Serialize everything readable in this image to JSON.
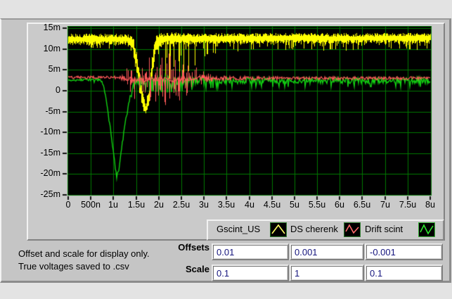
{
  "note": {
    "line1": "Offset and scale for display only.",
    "line2": "True voltages saved to .csv"
  },
  "controls": {
    "offsets": {
      "label": "Offsets",
      "values": [
        "0.01",
        "0.001",
        "-0.001"
      ]
    },
    "scale": {
      "label": "Scale",
      "values": [
        "0.1",
        "1",
        "0.1"
      ]
    },
    "value_text_color": "#15157e"
  },
  "legend": {
    "items": [
      {
        "label": "Gscint_US",
        "color": "#ffff66",
        "box_border": "#2d7a2d",
        "glyph": "2,15 11,3 20,15"
      },
      {
        "label": "DS cherenk",
        "color": "#ff6b6b",
        "box_border": "#2d7a2d",
        "glyph": "2,12 7,3 13,14 20,6"
      },
      {
        "label": "Drift scint",
        "color": "#2ee62e",
        "box_border": "#39b439",
        "glyph": "2,13 7,3 13,15 20,4"
      }
    ]
  },
  "chart_data": {
    "type": "line",
    "title": "",
    "bg": "#000000",
    "grid_color": "#007a00",
    "border_color": "#0a7a0a",
    "tick_color": "#111111",
    "grid": true,
    "legend_position": "bottom-right",
    "xlim_us": [
      0,
      8
    ],
    "ylim_mv": [
      -25,
      15
    ],
    "x_ticks": [
      {
        "label": "0",
        "us": 0
      },
      {
        "label": "500n",
        "us": 0.5
      },
      {
        "label": "1u",
        "us": 1
      },
      {
        "label": "1.5u",
        "us": 1.5
      },
      {
        "label": "2u",
        "us": 2
      },
      {
        "label": "2.5u",
        "us": 2.5
      },
      {
        "label": "3u",
        "us": 3
      },
      {
        "label": "3.5u",
        "us": 3.5
      },
      {
        "label": "4u",
        "us": 4
      },
      {
        "label": "4.5u",
        "us": 4.5
      },
      {
        "label": "5u",
        "us": 5
      },
      {
        "label": "5.5u",
        "us": 5.5
      },
      {
        "label": "6u",
        "us": 6
      },
      {
        "label": "6.5u",
        "us": 6.5
      },
      {
        "label": "7u",
        "us": 7
      },
      {
        "label": "7.5u",
        "us": 7.5
      },
      {
        "label": "8u",
        "us": 8
      }
    ],
    "y_ticks": [
      {
        "label": "15m",
        "mv": 15
      },
      {
        "label": "10m",
        "mv": 10
      },
      {
        "label": "5m",
        "mv": 5
      },
      {
        "label": "0",
        "mv": 0
      },
      {
        "label": "-5m",
        "mv": -5
      },
      {
        "label": "-10m",
        "mv": -10
      },
      {
        "label": "-15m",
        "mv": -15
      },
      {
        "label": "-20m",
        "mv": -20
      },
      {
        "label": "-25m",
        "mv": -25
      }
    ],
    "series": [
      {
        "name": "Gscint_US",
        "color": "#ffff00",
        "style": "band",
        "points": [
          [
            0,
            12.4,
            1.3,
            1.5
          ],
          [
            1.3,
            12.4,
            1.3,
            1.5
          ],
          [
            1.42,
            11.3,
            2.2,
            2
          ],
          [
            1.5,
            7.5,
            3,
            2
          ],
          [
            1.58,
            1.5,
            3,
            1.5
          ],
          [
            1.66,
            -3.2,
            2,
            0.8
          ],
          [
            1.71,
            -4.3,
            1.2,
            0.5
          ],
          [
            1.77,
            -1.5,
            2.5,
            1
          ],
          [
            1.84,
            5,
            3,
            2
          ],
          [
            1.92,
            11,
            2.2,
            3
          ],
          [
            2.02,
            12.3,
            1.6,
            7
          ],
          [
            2.12,
            12.5,
            1.5,
            11
          ],
          [
            2.25,
            12.6,
            1.4,
            13
          ],
          [
            2.42,
            12.6,
            1.4,
            11
          ],
          [
            2.6,
            12.5,
            1.3,
            8.5
          ],
          [
            2.85,
            12.5,
            1.3,
            6
          ],
          [
            3.1,
            12.5,
            1.2,
            4
          ],
          [
            3.4,
            12.6,
            1.2,
            2.6
          ],
          [
            4,
            12.6,
            1.2,
            2.2
          ],
          [
            5,
            12.7,
            1.2,
            2.2
          ],
          [
            6,
            12.6,
            1.2,
            2.2
          ],
          [
            7,
            12.7,
            1.2,
            2.2
          ],
          [
            8,
            12.7,
            1.2,
            2.2
          ]
        ]
      },
      {
        "name": "Drift scint",
        "color": "#12cf12",
        "style": "noisy_line",
        "points": [
          [
            0,
            2.6,
            0.25
          ],
          [
            0.68,
            2.6,
            0.3
          ],
          [
            0.76,
            2.2,
            0.3
          ],
          [
            0.83,
            -1.5,
            0.3
          ],
          [
            0.92,
            -8,
            0.3
          ],
          [
            1,
            -15,
            0.3
          ],
          [
            1.07,
            -20.4,
            0.3
          ],
          [
            1.12,
            -19,
            0.3
          ],
          [
            1.2,
            -12,
            0.3
          ],
          [
            1.3,
            -5,
            0.4
          ],
          [
            1.38,
            -1,
            0.5
          ],
          [
            1.45,
            1.6,
            0.6
          ],
          [
            1.55,
            2.1,
            0.8
          ],
          [
            1.7,
            2.2,
            1
          ],
          [
            1.9,
            2.3,
            1.2
          ],
          [
            2.2,
            2.3,
            1.3
          ],
          [
            2.5,
            2.4,
            1.2
          ],
          [
            2.8,
            2.4,
            1
          ],
          [
            3.1,
            2.4,
            0.85
          ],
          [
            3.5,
            2.4,
            0.75
          ],
          [
            4.2,
            2.4,
            0.7
          ],
          [
            5,
            2.4,
            0.7
          ],
          [
            6,
            2.4,
            0.7
          ],
          [
            7,
            2.4,
            0.7
          ],
          [
            8,
            2.4,
            0.7
          ]
        ]
      },
      {
        "name": "DS cherenk",
        "color": "#ff5a5a",
        "style": "spikes",
        "points": [
          [
            0,
            3.2,
            0.3
          ],
          [
            1.12,
            3.2,
            0.35
          ],
          [
            1.2,
            3.1,
            0.7
          ],
          [
            1.27,
            3,
            2
          ],
          [
            1.34,
            2.8,
            3.8
          ],
          [
            1.42,
            2.6,
            5
          ],
          [
            1.5,
            2.5,
            4.2
          ],
          [
            1.6,
            2.5,
            3.2
          ],
          [
            1.7,
            2.7,
            3.8
          ],
          [
            1.78,
            2.8,
            5.2
          ],
          [
            1.88,
            2.8,
            5.8
          ],
          [
            1.98,
            2.8,
            5.2
          ],
          [
            2.08,
            2.7,
            6.8
          ],
          [
            2.16,
            2.6,
            7.6
          ],
          [
            2.28,
            2.6,
            7.2
          ],
          [
            2.4,
            2.7,
            6.2
          ],
          [
            2.55,
            2.8,
            5
          ],
          [
            2.7,
            2.9,
            3.6
          ],
          [
            2.85,
            3,
            2.4
          ],
          [
            3,
            3,
            1.6
          ],
          [
            3.15,
            3,
            1
          ],
          [
            3.35,
            3,
            0.6
          ],
          [
            3.7,
            3,
            0.45
          ],
          [
            4.5,
            3,
            0.4
          ],
          [
            5.5,
            3,
            0.38
          ],
          [
            6.5,
            3,
            0.38
          ],
          [
            7.5,
            3,
            0.38
          ],
          [
            8,
            3,
            0.38
          ]
        ]
      }
    ]
  }
}
